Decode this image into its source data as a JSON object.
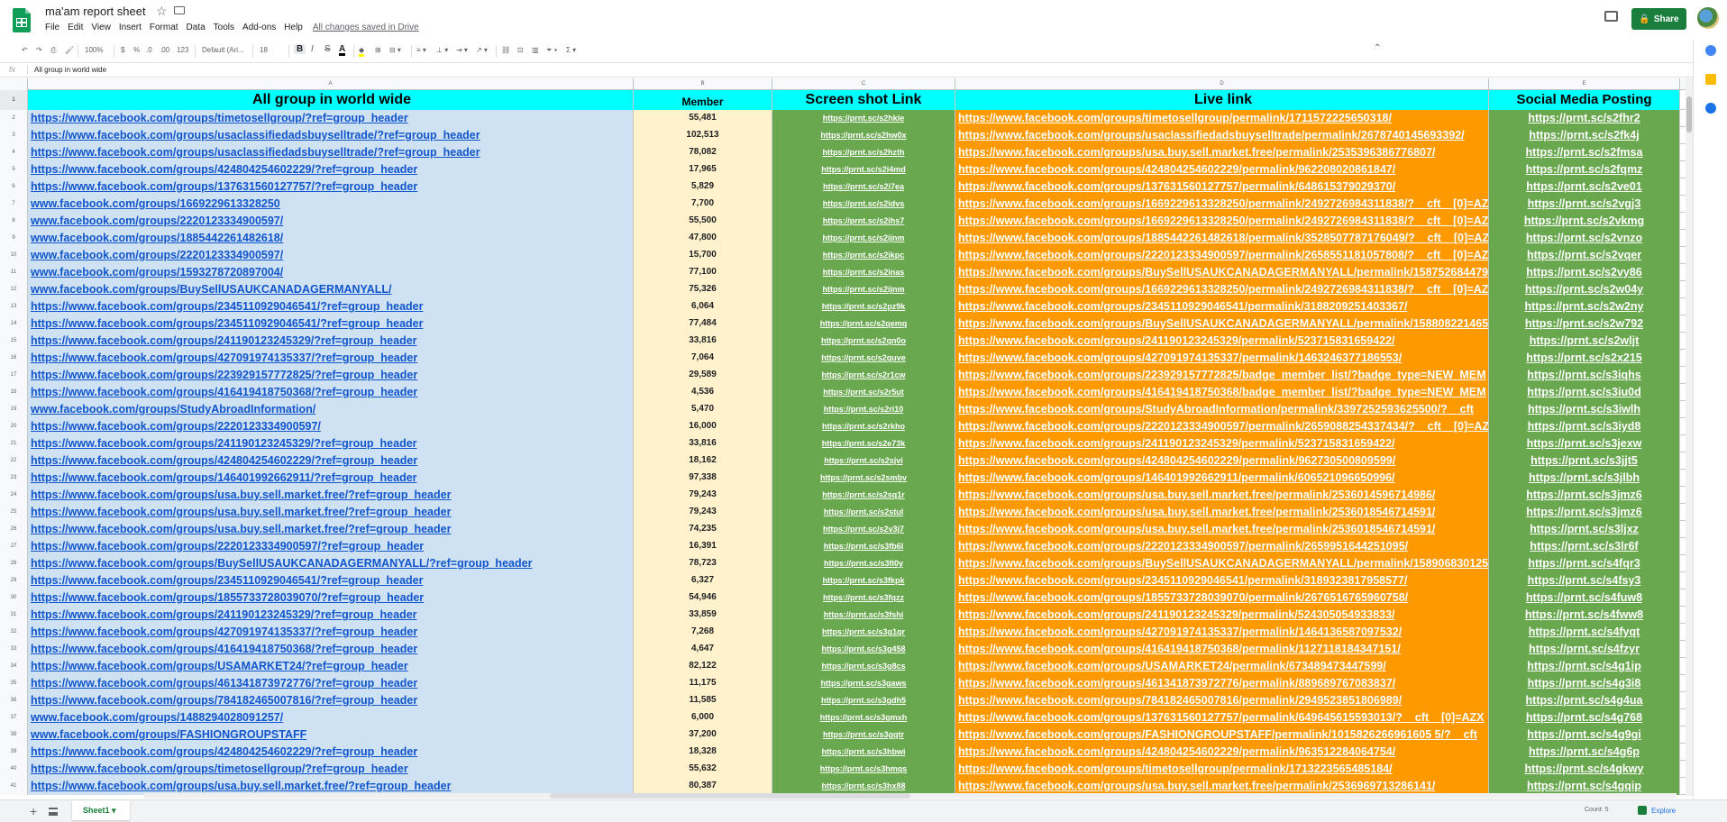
{
  "doc": {
    "title": "ma'am report sheet",
    "saved_status": "All changes saved in Drive"
  },
  "menu": [
    "File",
    "Edit",
    "View",
    "Insert",
    "Format",
    "Data",
    "Tools",
    "Add-ons",
    "Help"
  ],
  "share_label": "Share",
  "toolbar": {
    "zoom": "100%",
    "currency": "$",
    "percent": "%",
    "dec_less": ".0",
    "dec_more": ".00",
    "more_formats": "123",
    "font": "Default (Ari...",
    "font_size": "18",
    "bold": "B",
    "italic": "I",
    "strike": "S",
    "text_color": "A",
    "functions": "Σ"
  },
  "formula_bar": {
    "fx": "fx",
    "value": "All group in world wide"
  },
  "columns": [
    "A",
    "B",
    "C",
    "D",
    "E"
  ],
  "header_row": {
    "num": "1",
    "a": "All group in world wide",
    "b": "Member",
    "c": "Screen shot Link",
    "d": "Live link",
    "e": "Social Media Posting"
  },
  "rows": [
    {
      "num": "2",
      "a": "https://www.facebook.com/groups/timetosellgroup/?ref=group_header",
      "b": "55,481",
      "c": "https://prnt.sc/s2hkie",
      "d": "https://www.facebook.com/groups/timetosellgroup/permalink/1711572225650318/",
      "e": "https://prnt.sc/s2fhr2"
    },
    {
      "num": "3",
      "a": "https://www.facebook.com/groups/usaclassifiedadsbuyselltrade/?ref=group_header",
      "b": "102,513",
      "c": "https://prnt.sc/s2hw0x",
      "d": "https://www.facebook.com/groups/usaclassifiedadsbuyselltrade/permalink/2678740145693392/",
      "e": "https://prnt.sc/s2fk4j"
    },
    {
      "num": "4",
      "a": "https://www.facebook.com/groups/usaclassifiedadsbuyselltrade/?ref=group_header",
      "b": "78,082",
      "c": "https://prnt.sc/s2hzth",
      "d": "https://www.facebook.com/groups/usa.buy.sell.market.free/permalink/2535396386776807/",
      "e": "https://prnt.sc/s2fmsa"
    },
    {
      "num": "5",
      "a": "https://www.facebook.com/groups/424804254602229/?ref=group_header",
      "b": "17,965",
      "c": "https://prnt.sc/s2i4md",
      "d": "https://www.facebook.com/groups/424804254602229/permalink/962208020861847/",
      "e": "https://prnt.sc/s2fqmz"
    },
    {
      "num": "6",
      "a": "https://www.facebook.com/groups/137631560127757/?ref=group_header",
      "b": "5,829",
      "c": "https://prnt.sc/s2i7ea",
      "d": "https://www.facebook.com/groups/137631560127757/permalink/648615379029370/",
      "e": "https://prnt.sc/s2ve01"
    },
    {
      "num": "7",
      "a": "www.facebook.com/groups/1669229613328250",
      "b": "7,700",
      "c": "https://prnt.sc/s2idvs",
      "d": "https://www.facebook.com/groups/1669229613328250/permalink/2492726984311838/?__cft__[0]=AZ",
      "e": "https://prnt.sc/s2vgj3"
    },
    {
      "num": "8",
      "a": "www.facebook.com/groups/2220123334900597/",
      "b": "55,500",
      "c": "https://prnt.sc/s2ihs7",
      "d": "https://www.facebook.com/groups/1669229613328250/permalink/2492726984311838/?__cft__[0]=AZ",
      "e": "https://prnt.sc/s2vkmg"
    },
    {
      "num": "9",
      "a": "www.facebook.com/groups/1885442261482618/",
      "b": "47,800",
      "c": "https://prnt.sc/s2ijnm",
      "d": "https://www.facebook.com/groups/1885442261482618/permalink/3528507787176049/?__cft__[0]=AZ",
      "e": "https://prnt.sc/s2vnzo"
    },
    {
      "num": "10",
      "a": "www.facebook.com/groups/2220123334900597/",
      "b": "15,700",
      "c": "https://prnt.sc/s2ikpc",
      "d": "https://www.facebook.com/groups/2220123334900597/permalink/2658551181057808/?__cft__[0]=AZ",
      "e": "https://prnt.sc/s2vqer"
    },
    {
      "num": "11",
      "a": "www.facebook.com/groups/1593278720897004/",
      "b": "77,100",
      "c": "https://prnt.sc/s2inas",
      "d": "https://www.facebook.com/groups/BuySellUSAUKCANADAGERMANYALL/permalink/158752684479",
      "e": "https://prnt.sc/s2vy86"
    },
    {
      "num": "12",
      "a": "www.facebook.com/groups/BuySellUSAUKCANADAGERMANYALL/",
      "b": "75,326",
      "c": "https://prnt.sc/s2ijnm",
      "d": "https://www.facebook.com/groups/1669229613328250/permalink/2492726984311838/?__cft__[0]=AZ",
      "e": "https://prnt.sc/s2w04y"
    },
    {
      "num": "13",
      "a": "https://www.facebook.com/groups/2345110929046541/?ref=group_header",
      "b": "6,064",
      "c": "https://prnt.sc/s2pz9k",
      "d": "https://www.facebook.com/groups/2345110929046541/permalink/3188209251403367/",
      "e": "https://prnt.sc/s2w2ny"
    },
    {
      "num": "14",
      "a": "https://www.facebook.com/groups/2345110929046541/?ref=group_header",
      "b": "77,484",
      "c": "https://prnt.sc/s2qemq",
      "d": "https://www.facebook.com/groups/BuySellUSAUKCANADAGERMANYALL/permalink/158808221465",
      "e": "https://prnt.sc/s2w792"
    },
    {
      "num": "15",
      "a": "https://www.facebook.com/groups/241190123245329/?ref=group_header",
      "b": "33,816",
      "c": "https://prnt.sc/s2qn0o",
      "d": "https://www.facebook.com/groups/241190123245329/permalink/523715831659422/",
      "e": "https://prnt.sc/s2wljt"
    },
    {
      "num": "16",
      "a": "https://www.facebook.com/groups/427091974135337/?ref=group_header",
      "b": "7,064",
      "c": "https://prnt.sc/s2quve",
      "d": "https://www.facebook.com/groups/427091974135337/permalink/1463246377186553/",
      "e": "https://prnt.sc/s2x215"
    },
    {
      "num": "17",
      "a": "https://www.facebook.com/groups/223929157772825/?ref=group_header",
      "b": "29,589",
      "c": "https://prnt.sc/s2r1cw",
      "d": "https://www.facebook.com/groups/223929157772825/badge_member_list/?badge_type=NEW_MEM",
      "e": "https://prnt.sc/s3iqhs"
    },
    {
      "num": "18",
      "a": "https://www.facebook.com/groups/416419418750368/?ref=group_header",
      "b": "4,536",
      "c": "https://prnt.sc/s2r5ut",
      "d": "https://www.facebook.com/groups/416419418750368/badge_member_list/?badge_type=NEW_MEM",
      "e": "https://prnt.sc/s3iu0d"
    },
    {
      "num": "19",
      "a": "www.facebook.com/groups/StudyAbroadInformation/",
      "b": "5,470",
      "c": "https://prnt.sc/s2ri10",
      "d": "https://www.facebook.com/groups/StudyAbroadInformation/permalink/3397252593625500/?__cft",
      "e": "https://prnt.sc/s3iwlh"
    },
    {
      "num": "20",
      "a": "https://www.facebook.com/groups/2220123334900597/",
      "b": "16,000",
      "c": "https://prnt.sc/s2rkho",
      "d": "https://www.facebook.com/groups/2220123334900597/permalink/2659088254337434/?__cft__[0]=AZ",
      "e": "https://prnt.sc/s3iyd8"
    },
    {
      "num": "21",
      "a": "https://www.facebook.com/groups/241190123245329/?ref=group_header",
      "b": "33,816",
      "c": "https://prnt.sc/s2e73k",
      "d": "https://www.facebook.com/groups/241190123245329/permalink/523715831659422/",
      "e": "https://prnt.sc/s3jexw"
    },
    {
      "num": "22",
      "a": "https://www.facebook.com/groups/424804254602229/?ref=group_header",
      "b": "18,162",
      "c": "https://prnt.sc/s2sjvi",
      "d": "https://www.facebook.com/groups/424804254602229/permalink/962730500809599/",
      "e": "https://prnt.sc/s3jjt5"
    },
    {
      "num": "23",
      "a": "https://www.facebook.com/groups/146401992662911/?ref=group_header",
      "b": "97,338",
      "c": "https://prnt.sc/s2smbv",
      "d": "https://www.facebook.com/groups/146401992662911/permalink/606521096650996/",
      "e": "https://prnt.sc/s3jlbh"
    },
    {
      "num": "24",
      "a": "https://www.facebook.com/groups/usa.buy.sell.market.free/?ref=group_header",
      "b": "79,243",
      "c": "https://prnt.sc/s2sq1r",
      "d": "https://www.facebook.com/groups/usa.buy.sell.market.free/permalink/2536014596714986/",
      "e": "https://prnt.sc/s3jmz6"
    },
    {
      "num": "25",
      "a": "https://www.facebook.com/groups/usa.buy.sell.market.free/?ref=group_header",
      "b": "79,243",
      "c": "https://prnt.sc/s2stul",
      "d": "https://www.facebook.com/groups/usa.buy.sell.market.free/permalink/2536018546714591/",
      "e": "https://prnt.sc/s3jmz6"
    },
    {
      "num": "26",
      "a": "https://www.facebook.com/groups/usa.buy.sell.market.free/?ref=group_header",
      "b": "74,235",
      "c": "https://prnt.sc/s2v3j7",
      "d": "https://www.facebook.com/groups/usa.buy.sell.market.free/permalink/2536018546714591/",
      "e": "https://prnt.sc/s3ljxz"
    },
    {
      "num": "27",
      "a": "https://www.facebook.com/groups/2220123334900597/?ref=group_header",
      "b": "16,391",
      "c": "https://prnt.sc/s3fb6l",
      "d": "https://www.facebook.com/groups/2220123334900597/permalink/2659951644251095/",
      "e": "https://prnt.sc/s3lr6f"
    },
    {
      "num": "28",
      "a": "https://www.facebook.com/groups/BuySellUSAUKCANADAGERMANYALL/?ref=group_header",
      "b": "78,723",
      "c": "https://prnt.sc/s3fi0y",
      "d": "https://www.facebook.com/groups/BuySellUSAUKCANADAGERMANYALL/permalink/158906830125",
      "e": "https://prnt.sc/s4fqr3"
    },
    {
      "num": "29",
      "a": "https://www.facebook.com/groups/2345110929046541/?ref=group_header",
      "b": "6,327",
      "c": "https://prnt.sc/s3fkpk",
      "d": "https://www.facebook.com/groups/2345110929046541/permalink/3189323817958577/",
      "e": "https://prnt.sc/s4fsy3"
    },
    {
      "num": "30",
      "a": "https://www.facebook.com/groups/1855733728039070/?ref=group_header",
      "b": "54,946",
      "c": "https://prnt.sc/s3fqzz",
      "d": "https://www.facebook.com/groups/1855733728039070/permalink/2676516765960758/",
      "e": "https://prnt.sc/s4fuw8"
    },
    {
      "num": "31",
      "a": "https://www.facebook.com/groups/241190123245329/?ref=group_header",
      "b": "33,859",
      "c": "https://prnt.sc/s3fshi",
      "d": "https://www.facebook.com/groups/241190123245329/permalink/524305054933833/",
      "e": "https://prnt.sc/s4fww8"
    },
    {
      "num": "32",
      "a": "https://www.facebook.com/groups/427091974135337/?ref=group_header",
      "b": "7,268",
      "c": "https://prnt.sc/s3g1qr",
      "d": "https://www.facebook.com/groups/427091974135337/permalink/1464136587097532/",
      "e": "https://prnt.sc/s4fyqt"
    },
    {
      "num": "33",
      "a": "https://www.facebook.com/groups/416419418750368/?ref=group_header",
      "b": "4,647",
      "c": "https://prnt.sc/s3g458",
      "d": "https://www.facebook.com/groups/416419418750368/permalink/1127118184347151/",
      "e": "https://prnt.sc/s4fzyr"
    },
    {
      "num": "34",
      "a": "https://www.facebook.com/groups/USAMARKET24/?ref=group_header",
      "b": "82,122",
      "c": "https://prnt.sc/s3g8cs",
      "d": "https://www.facebook.com/groups/USAMARKET24/permalink/673489473447599/",
      "e": "https://prnt.sc/s4g1ip"
    },
    {
      "num": "35",
      "a": "https://www.facebook.com/groups/461341873972776/?ref=group_header",
      "b": "11,175",
      "c": "https://prnt.sc/s3gaws",
      "d": "https://www.facebook.com/groups/461341873972776/permalink/889689767083837/",
      "e": "https://prnt.sc/s4g3i8"
    },
    {
      "num": "36",
      "a": "https://www.facebook.com/groups/784182465007816/?ref=group_header",
      "b": "11,585",
      "c": "https://prnt.sc/s3gdh5",
      "d": "https://www.facebook.com/groups/784182465007816/permalink/2949523851806989/",
      "e": "https://prnt.sc/s4g4ua"
    },
    {
      "num": "37",
      "a": "www.facebook.com/groups/1488294028091257/",
      "b": "6,000",
      "c": "https://prnt.sc/s3gmxh",
      "d": "https://www.facebook.com/groups/137631560127757/permalink/649645615593013/?__cft__[0]=AZX",
      "e": "https://prnt.sc/s4g768"
    },
    {
      "num": "38",
      "a": "www.facebook.com/groups/FASHIONGROUPSTAFF",
      "b": "37,200",
      "c": "https://prnt.sc/s3gqtr",
      "d": "https://www.facebook.com/groups/FASHIONGROUPSTAFF/permalink/1015826266961605 5/?__cft",
      "e": "https://prnt.sc/s4g9gi"
    },
    {
      "num": "39",
      "a": "https://www.facebook.com/groups/424804254602229/?ref=group_header",
      "b": "18,328",
      "c": "https://prnt.sc/s3hbwi",
      "d": "https://www.facebook.com/groups/424804254602229/permalink/963512284064754/",
      "e": "https://prnt.sc/s4g6p"
    },
    {
      "num": "40",
      "a": "https://www.facebook.com/groups/timetosellgroup/?ref=group_header",
      "b": "55,632",
      "c": "https://prnt.sc/s3hmqs",
      "d": "https://www.facebook.com/groups/timetosellgroup/permalink/1713223565485184/",
      "e": "https://prnt.sc/s4gkwy"
    },
    {
      "num": "41",
      "a": "https://www.facebook.com/groups/usa.buy.sell.market.free/?ref=group_header",
      "b": "80,387",
      "c": "https://prnt.sc/s3hx88",
      "d": "https://www.facebook.com/groups/usa.buy.sell.market.free/permalink/2536969713286141/",
      "e": "https://prnt.sc/s4gqip"
    }
  ],
  "bottom": {
    "add": "+",
    "sheet_tab": "Sheet1 ▾",
    "count": "Count: 5",
    "explore": "Explore"
  },
  "colors": {
    "col_a": "#cfe2f3",
    "col_b": "#fff2cc",
    "col_c": "#6aa84f",
    "col_d": "#ff9900",
    "col_e": "#6aa84f",
    "header": "#00ffff"
  }
}
